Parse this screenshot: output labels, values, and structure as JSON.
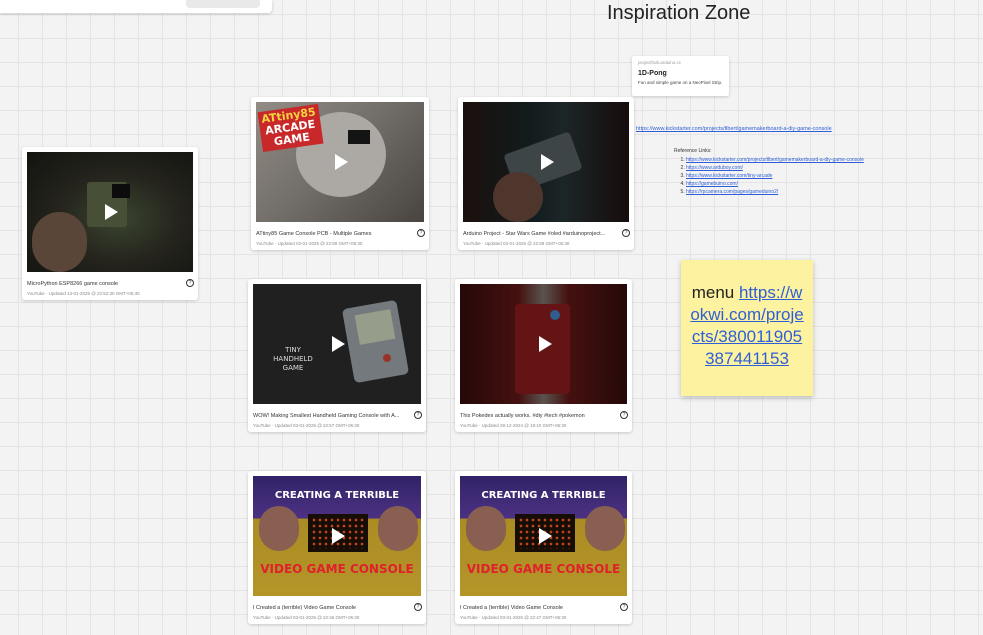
{
  "board": {
    "title": "Inspiration Zone"
  },
  "cards": [
    {
      "title": "MicroPython ESP8266 game console",
      "meta": "YouTube · Updated 13-01-2025 @ 22:52:30 GMT+05:30"
    },
    {
      "title": "ATtiny85 Game Console PCB - Multiple Games",
      "meta": "YouTube · Updated 03-01-2025 @ 22:59 GMT+05:30",
      "thumb_lines": [
        "ATtiny85",
        "ARCADE",
        "GAME"
      ]
    },
    {
      "title": "Arduino Project - Star Wars Game #oled #arduinoproject...",
      "meta": "YouTube · Updated 03-01-2025 @ 22:58 GMT+05:30"
    },
    {
      "title": "WOW! Making Smallest Handheld Gaming Console with A...",
      "meta": "YouTube · Updated 03-01-2025 @ 22:57 GMT+05:30",
      "thumb_lines": [
        "TINY",
        "HANDHELD",
        "GAME"
      ]
    },
    {
      "title": "This Pokedex actually works. #diy #tech #pokemon",
      "meta": "YouTube · Updated 28-12-2024 @ 19:10 GMT+05:30"
    },
    {
      "title": "I Created a (terrible) Video Game Console",
      "meta": "YouTube · Updated 03-01-2025 @ 22:46 GMT+05:30",
      "thumb_lines": [
        "CREATING A TERRIBLE",
        "VIDEO GAME CONSOLE"
      ]
    },
    {
      "title": "I Created a (terrible) Video Game Console",
      "meta": "YouTube · Updated 03-01-2025 @ 22:47 GMT+05:30",
      "thumb_lines": [
        "CREATING A TERRIBLE",
        "VIDEO GAME CONSOLE"
      ]
    }
  ],
  "link_card": {
    "source": "projecthub.arduino.cc",
    "title": "1D-Pong",
    "description": "Fun and simple game on a NeoPixel Strip."
  },
  "url_line": "https://www.kickstarter.com/projects/tlbert/gamemakerboard-a-diy-game-console",
  "references": {
    "title": "Reference Links:",
    "items": [
      "https://www.kickstarter.com/projects/tlbert/gamemakerboard-a-diy-game-console",
      "https://www.arduboy.com/",
      "https://www.kickstarter.com/tiny-arcade",
      "https://gamebuino.com/",
      "https://rpcamera.com/pages/gameduino2/"
    ]
  },
  "sticky": {
    "prefix": "menu",
    "link": "https://wokwi.com/projects/380011905387441153"
  },
  "colors": {
    "sticky": "#fdf2a0",
    "link": "#2f5fd6"
  }
}
